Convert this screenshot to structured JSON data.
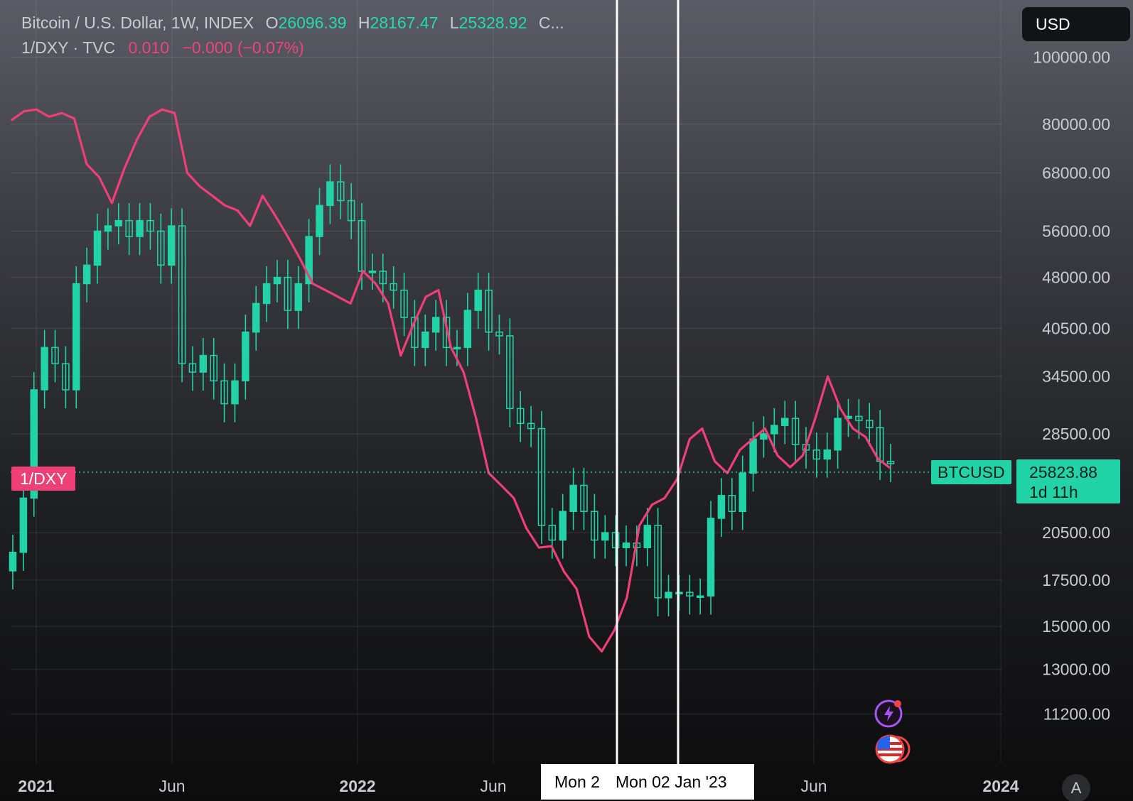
{
  "header": {
    "symbol": "Bitcoin / U.S. Dollar, 1W, INDEX",
    "open_label": "O",
    "open": "26096.39",
    "high_label": "H",
    "high": "28167.47",
    "low_label": "L",
    "low": "25328.92",
    "close_label": "C...",
    "overlay_symbol": "1/DXY · TVC",
    "overlay_value": "0.010",
    "overlay_change": "−0.000 (−0.07%)"
  },
  "currency_button": "USD",
  "overlay_tag": "1/DXY",
  "symbol_tag": "BTCUSD",
  "last_price": "25823.88",
  "countdown": "1d 11h",
  "crosshair_dates": [
    "Mon 2",
    "Mon 02 Jan '23"
  ],
  "scale_mode_button": "A",
  "icons": {
    "alert": "lightning-icon",
    "events": "us-flag-icon"
  },
  "colors": {
    "btc": "#22d3a8",
    "dxy": "#ef3f77",
    "crosshair": "#ffffff"
  },
  "chart_data": {
    "type": "line",
    "scale": "log",
    "x_ticks": [
      "2021",
      "Jun",
      "2022",
      "Jun",
      "Mon 02 Jan '23",
      "Jun",
      "2024"
    ],
    "y_ticks": [
      "100000.00",
      "80000.00",
      "68000.00",
      "56000.00",
      "48000.00",
      "40500.00",
      "34500.00",
      "28500.00",
      "20500.00",
      "17500.00",
      "15000.00",
      "13000.00",
      "11200.00"
    ],
    "ylim": [
      10000,
      105000
    ],
    "grid": true,
    "series": [
      {
        "name": "BTCUSD",
        "values": [
          19200,
          23000,
          33000,
          38000,
          36000,
          33000,
          47000,
          50000,
          56000,
          57000,
          58000,
          55000,
          58000,
          56000,
          50000,
          57000,
          36000,
          35000,
          37000,
          34000,
          31500,
          34000,
          40000,
          44000,
          47000,
          48000,
          43000,
          47000,
          55000,
          61000,
          66000,
          62000,
          58000,
          49000,
          49000,
          47000,
          46000,
          42000,
          38000,
          40000,
          42000,
          38000,
          38000,
          43000,
          46000,
          40000,
          39500,
          31000,
          29500,
          29000,
          21000,
          20000,
          22000,
          24000,
          22000,
          20000,
          20500,
          19500,
          19800,
          19500,
          21000,
          16500,
          16800,
          16800,
          16600,
          16600,
          21500,
          23200,
          22000,
          25000,
          28000,
          28500,
          29300,
          30000,
          27500,
          27000,
          26200,
          27000,
          30000,
          30200,
          29800,
          29100,
          26000,
          25800
        ]
      },
      {
        "name": "1/DXY",
        "values": [
          81000,
          83500,
          84000,
          82000,
          83000,
          81500,
          70000,
          67000,
          61500,
          69000,
          76000,
          82000,
          84000,
          83000,
          68000,
          65000,
          63000,
          61000,
          60000,
          57000,
          63000,
          59000,
          55000,
          51000,
          47000,
          46000,
          45000,
          44000,
          49000,
          47000,
          44000,
          37000,
          41000,
          45000,
          46000,
          38000,
          35000,
          30000,
          25000,
          24000,
          23000,
          20800,
          19500,
          19600,
          18000,
          17000,
          14500,
          13800,
          14800,
          16500,
          21000,
          22500,
          23000,
          24500,
          28000,
          29000,
          26000,
          25000,
          27000,
          28000,
          29000,
          26500,
          25500,
          26500,
          30000,
          34500,
          31000,
          29000,
          28200,
          26200,
          25400
        ]
      }
    ]
  }
}
